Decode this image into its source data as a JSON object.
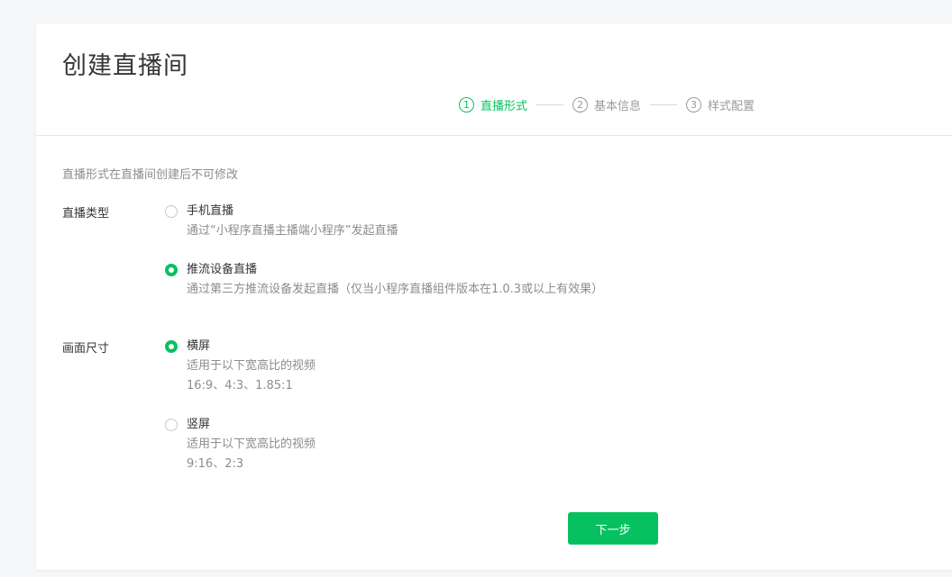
{
  "page": {
    "title": "创建直播间"
  },
  "steps": [
    {
      "num": "1",
      "label": "直播形式",
      "active": true
    },
    {
      "num": "2",
      "label": "基本信息",
      "active": false
    },
    {
      "num": "3",
      "label": "样式配置",
      "active": false
    }
  ],
  "notice": "直播形式在直播间创建后不可修改",
  "live_type": {
    "label": "直播类型",
    "options": [
      {
        "title": "手机直播",
        "desc": "通过“小程序直播主播端小程序”发起直播",
        "checked": false
      },
      {
        "title": "推流设备直播",
        "desc": "通过第三方推流设备发起直播（仅当小程序直播组件版本在1.0.3或以上有效果）",
        "checked": true
      }
    ]
  },
  "screen_size": {
    "label": "画面尺寸",
    "options": [
      {
        "title": "横屏",
        "desc": "适用于以下宽高比的视频",
        "ratios": "16:9、4:3、1.85:1",
        "checked": true
      },
      {
        "title": "竖屏",
        "desc": "适用于以下宽高比的视频",
        "ratios": "9:16、2:3",
        "checked": false
      }
    ]
  },
  "actions": {
    "next_label": "下一步"
  },
  "colors": {
    "accent": "#07c160"
  }
}
